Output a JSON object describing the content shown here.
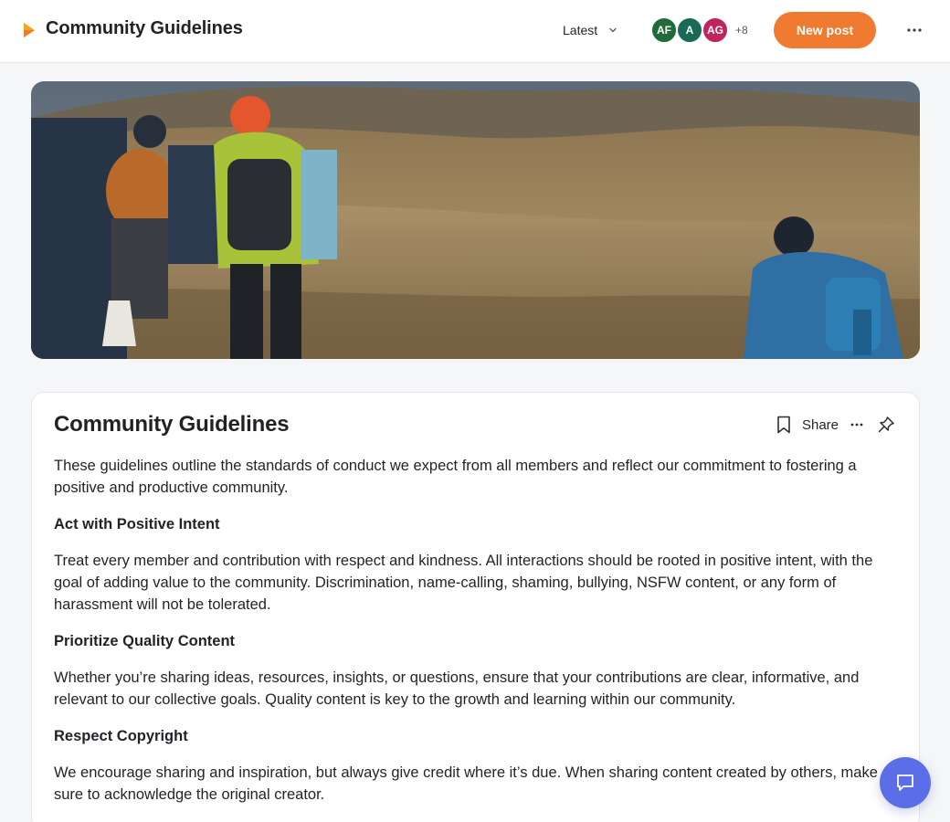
{
  "header": {
    "title": "Community Guidelines",
    "sort_label": "Latest",
    "avatars": [
      {
        "initials": "AF",
        "color": "#1f6b3a"
      },
      {
        "initials": "A",
        "color": "#1b6a55"
      },
      {
        "initials": "AG",
        "color": "#c0245f"
      }
    ],
    "member_extra": "+8",
    "new_post_label": "New post",
    "accent_color": "#f07a2f"
  },
  "cover": {
    "description_icon": "photo-banner"
  },
  "post": {
    "title": "Community Guidelines",
    "share_label": "Share",
    "intro": "These guidelines outline the standards of conduct we expect from all members and reflect our commitment to fostering a positive and productive community.",
    "sections": [
      {
        "heading": "Act with Positive Intent",
        "text": "Treat every member and contribution with respect and kindness. All interactions should be rooted in positive intent, with the goal of adding value to the community. Discrimination, name-calling, shaming, bullying, NSFW content, or any form of harassment will not be tolerated."
      },
      {
        "heading": "Prioritize Quality Content",
        "text": "Whether you’re sharing ideas, resources, insights, or questions, ensure that your contributions are clear, informative, and relevant to our collective goals. Quality content is key to the growth and learning within our community."
      },
      {
        "heading": "Respect Copyright",
        "text": "We encourage sharing and inspiration, but always give credit where it’s due. When sharing content created by others, make sure to acknowledge the original creator."
      }
    ]
  },
  "icons": {
    "space": "play-triangle-icon",
    "sort": "chevron-down-icon",
    "more": "ellipsis-icon",
    "bookmark": "bookmark-icon",
    "pin": "pin-icon",
    "chat": "chat-bubble-icon"
  }
}
